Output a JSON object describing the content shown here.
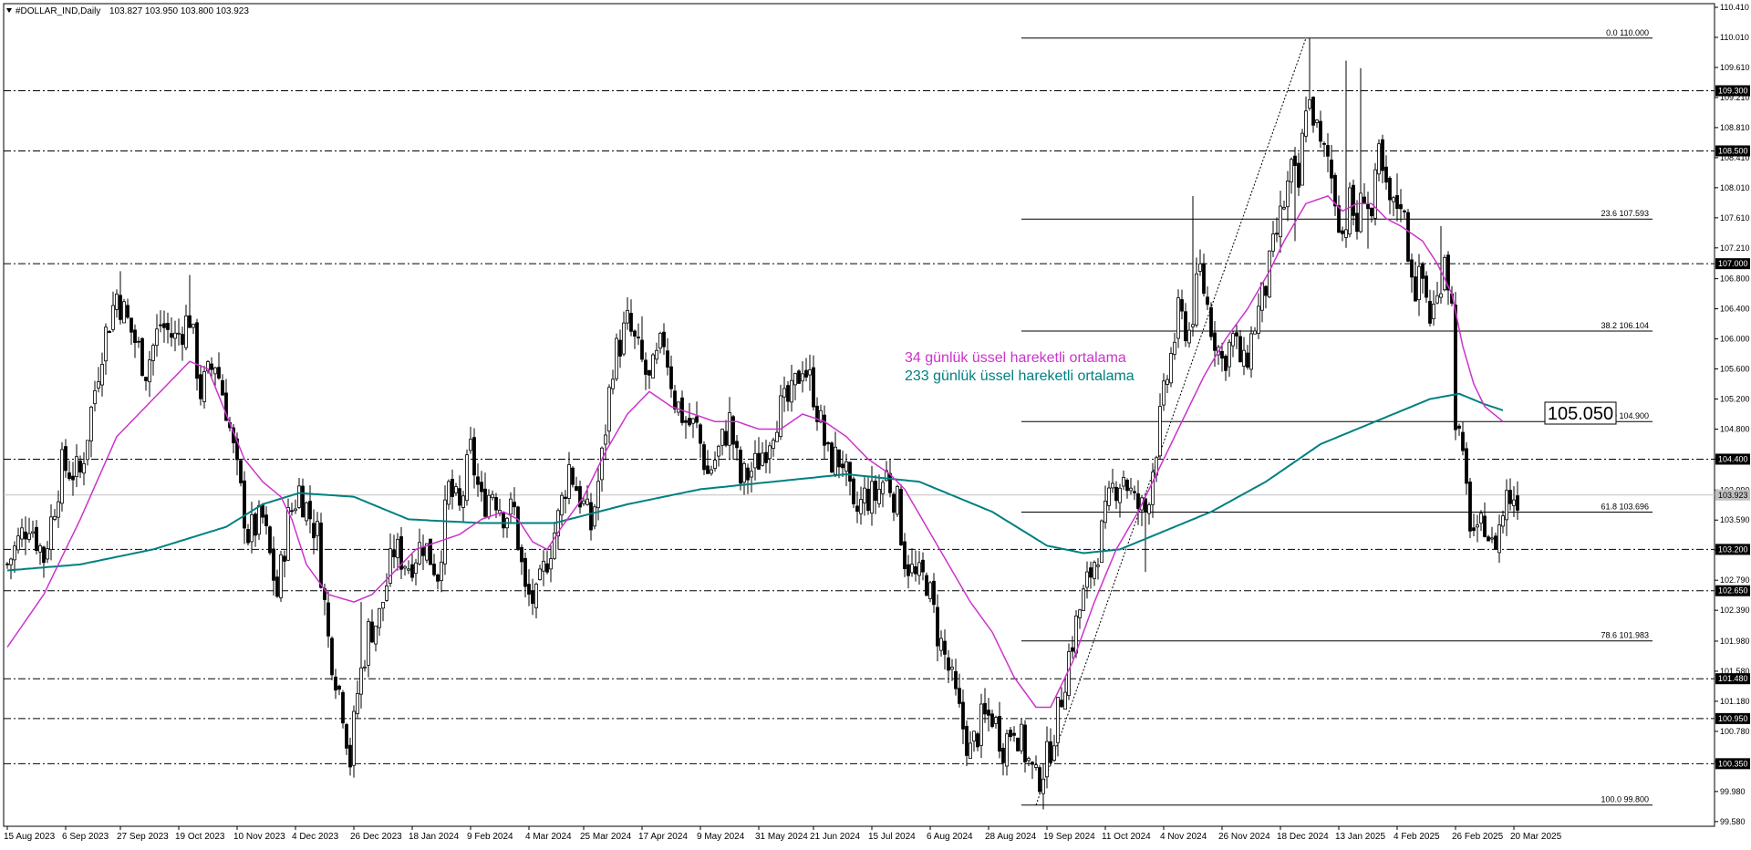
{
  "header": {
    "symbol_label": "#DOLLAR_IND,Daily",
    "ohlc_label": "103.827 103.950 103.800 103.923",
    "menu_icon": "triangle-down-icon"
  },
  "legend": {
    "ema34_label": "34 günlük üssel hareketli ortalama",
    "ema233_label": "233 günlük üssel hareketli ortalama"
  },
  "callout": {
    "value_label": "105.050"
  },
  "chart_data": {
    "type": "candlestick",
    "title": "",
    "xlabel": "",
    "ylabel": "",
    "ylim": [
      99.59,
      110.41
    ],
    "grid": false,
    "background": "#ffffff",
    "colors": {
      "candles": "#000000",
      "ema34": "#cc33cc",
      "ema233": "#008080",
      "levels": "#000000",
      "current_price_line": "#c0c0c0",
      "fibonacci": "#000000"
    },
    "y_ticks": [
      "110.410",
      "110.010",
      "109.610",
      "109.210",
      "108.810",
      "108.410",
      "108.010",
      "107.610",
      "107.210",
      "106.800",
      "106.400",
      "106.000",
      "105.600",
      "105.200",
      "104.800",
      "104.400",
      "103.990",
      "103.590",
      "103.190",
      "102.790",
      "102.390",
      "101.980",
      "101.580",
      "101.180",
      "100.780",
      "100.380",
      "99.980",
      "99.580"
    ],
    "x_ticks": [
      {
        "label": "15 Aug 2023",
        "i": 0
      },
      {
        "label": "6 Sep 2023",
        "i": 16
      },
      {
        "label": "27 Sep 2023",
        "i": 31
      },
      {
        "label": "19 Oct 2023",
        "i": 47
      },
      {
        "label": "10 Nov 2023",
        "i": 63
      },
      {
        "label": "4 Dec 2023",
        "i": 79
      },
      {
        "label": "26 Dec 2023",
        "i": 95
      },
      {
        "label": "18 Jan 2024",
        "i": 111
      },
      {
        "label": "9 Feb 2024",
        "i": 127
      },
      {
        "label": "4 Mar 2024",
        "i": 143
      },
      {
        "label": "25 Mar 2024",
        "i": 158
      },
      {
        "label": "17 Apr 2024",
        "i": 174
      },
      {
        "label": "9 May 2024",
        "i": 190
      },
      {
        "label": "31 May 2024",
        "i": 206
      },
      {
        "label": "21 Jun 2024",
        "i": 221
      },
      {
        "label": "15 Jul 2024",
        "i": 237
      },
      {
        "label": "6 Aug 2024",
        "i": 253
      },
      {
        "label": "28 Aug 2024",
        "i": 269
      },
      {
        "label": "19 Sep 2024",
        "i": 285
      },
      {
        "label": "11 Oct 2024",
        "i": 301
      },
      {
        "label": "4 Nov 2024",
        "i": 317
      },
      {
        "label": "26 Nov 2024",
        "i": 333
      },
      {
        "label": "18 Dec 2024",
        "i": 349
      },
      {
        "label": "13 Jan 2025",
        "i": 365
      },
      {
        "label": "4 Feb 2025",
        "i": 381
      },
      {
        "label": "26 Feb 2025",
        "i": 397
      },
      {
        "label": "20 Mar 2025",
        "i": 413
      }
    ],
    "total_bars": 418,
    "horizontal_levels": [
      {
        "value": 109.3,
        "label": "109.300"
      },
      {
        "value": 108.5,
        "label": "108.500"
      },
      {
        "value": 107.0,
        "label": "107.000"
      },
      {
        "value": 104.4,
        "label": "104.400"
      },
      {
        "value": 103.2,
        "label": "103.200"
      },
      {
        "value": 102.65,
        "label": "102.650"
      },
      {
        "value": 101.48,
        "label": "101.480"
      },
      {
        "value": 100.95,
        "label": "100.950"
      },
      {
        "value": 100.35,
        "label": "100.350"
      }
    ],
    "current_price": {
      "value": 103.923,
      "label": "103.923"
    },
    "fibonacci": {
      "start_i": 278,
      "end_i": 451,
      "swing_low": {
        "i": 282,
        "value": 99.8
      },
      "swing_high": {
        "i": 356,
        "value": 110.0
      },
      "levels": [
        {
          "value": 110.0,
          "label": "0.0 110.000"
        },
        {
          "value": 107.593,
          "label": "23.6 107.593"
        },
        {
          "value": 106.104,
          "label": "38.2 106.104"
        },
        {
          "value": 104.9,
          "label": "50.0 104.900"
        },
        {
          "value": 103.696,
          "label": "61.8 103.696"
        },
        {
          "value": 101.983,
          "label": "78.6 101.983"
        },
        {
          "value": 99.8,
          "label": "100.0 99.800"
        }
      ]
    },
    "close_path": [
      [
        0,
        103.0
      ],
      [
        6,
        103.6
      ],
      [
        10,
        103.1
      ],
      [
        15,
        104.3
      ],
      [
        20,
        104.2
      ],
      [
        26,
        105.9
      ],
      [
        30,
        106.6
      ],
      [
        34,
        106.1
      ],
      [
        38,
        105.6
      ],
      [
        42,
        106.2
      ],
      [
        46,
        106.0
      ],
      [
        50,
        106.3
      ],
      [
        53,
        105.3
      ],
      [
        57,
        105.7
      ],
      [
        60,
        105.1
      ],
      [
        63,
        104.2
      ],
      [
        66,
        103.4
      ],
      [
        70,
        103.6
      ],
      [
        74,
        102.6
      ],
      [
        77,
        103.6
      ],
      [
        80,
        104.0
      ],
      [
        85,
        103.4
      ],
      [
        88,
        102.0
      ],
      [
        92,
        101.1
      ],
      [
        94,
        100.4
      ],
      [
        96,
        101.3
      ],
      [
        99,
        102.1
      ],
      [
        102,
        102.3
      ],
      [
        106,
        103.2
      ],
      [
        110,
        103.0
      ],
      [
        114,
        103.3
      ],
      [
        118,
        102.9
      ],
      [
        121,
        104.0
      ],
      [
        124,
        103.7
      ],
      [
        127,
        104.5
      ],
      [
        130,
        103.8
      ],
      [
        133,
        104.0
      ],
      [
        136,
        103.7
      ],
      [
        139,
        103.7
      ],
      [
        142,
        102.6
      ],
      [
        145,
        102.5
      ],
      [
        148,
        103.1
      ],
      [
        151,
        103.6
      ],
      [
        154,
        104.3
      ],
      [
        157,
        103.9
      ],
      [
        160,
        103.5
      ],
      [
        163,
        104.4
      ],
      [
        166,
        105.7
      ],
      [
        170,
        106.2
      ],
      [
        173,
        105.8
      ],
      [
        176,
        105.4
      ],
      [
        180,
        106.0
      ],
      [
        183,
        105.2
      ],
      [
        186,
        104.9
      ],
      [
        189,
        104.8
      ],
      [
        192,
        104.2
      ],
      [
        195,
        104.5
      ],
      [
        198,
        104.9
      ],
      [
        201,
        104.1
      ],
      [
        205,
        104.3
      ],
      [
        208,
        104.6
      ],
      [
        211,
        105.0
      ],
      [
        215,
        105.2
      ],
      [
        218,
        105.7
      ],
      [
        221,
        105.3
      ],
      [
        225,
        104.4
      ],
      [
        229,
        104.4
      ],
      [
        232,
        103.6
      ],
      [
        235,
        103.9
      ],
      [
        238,
        103.9
      ],
      [
        241,
        104.2
      ],
      [
        244,
        103.8
      ],
      [
        246,
        103.1
      ],
      [
        249,
        102.8
      ],
      [
        252,
        102.8
      ],
      [
        255,
        102.1
      ],
      [
        258,
        101.6
      ],
      [
        261,
        101.0
      ],
      [
        264,
        100.5
      ],
      [
        267,
        100.9
      ],
      [
        270,
        101.0
      ],
      [
        273,
        100.6
      ],
      [
        276,
        100.9
      ],
      [
        279,
        100.5
      ],
      [
        282,
        100.1
      ],
      [
        285,
        100.4
      ],
      [
        288,
        101.0
      ],
      [
        291,
        101.8
      ],
      [
        294,
        102.4
      ],
      [
        297,
        102.9
      ],
      [
        300,
        103.4
      ],
      [
        303,
        104.0
      ],
      [
        306,
        104.2
      ],
      [
        309,
        103.8
      ],
      [
        312,
        103.7
      ],
      [
        315,
        104.6
      ],
      [
        318,
        105.5
      ],
      [
        321,
        106.3
      ],
      [
        324,
        106.1
      ],
      [
        327,
        106.9
      ],
      [
        330,
        106.2
      ],
      [
        333,
        105.7
      ],
      [
        336,
        106.0
      ],
      [
        339,
        105.6
      ],
      [
        342,
        106.2
      ],
      [
        345,
        106.7
      ],
      [
        348,
        107.4
      ],
      [
        350,
        107.8
      ],
      [
        352,
        108.2
      ],
      [
        354,
        108.0
      ],
      [
        356,
        109.2
      ],
      [
        358,
        109.0
      ],
      [
        360,
        108.5
      ],
      [
        362,
        108.4
      ],
      [
        364,
        107.9
      ],
      [
        366,
        107.4
      ],
      [
        368,
        107.8
      ],
      [
        370,
        107.5
      ],
      [
        372,
        108.0
      ],
      [
        374,
        107.6
      ],
      [
        376,
        108.4
      ],
      [
        378,
        107.9
      ],
      [
        380,
        107.7
      ],
      [
        382,
        107.9
      ],
      [
        384,
        107.2
      ],
      [
        386,
        106.7
      ],
      [
        388,
        106.8
      ],
      [
        390,
        106.3
      ],
      [
        392,
        106.5
      ],
      [
        394,
        107.2
      ],
      [
        396,
        106.4
      ],
      [
        397,
        105.0
      ],
      [
        399,
        104.3
      ],
      [
        401,
        103.6
      ],
      [
        403,
        103.3
      ],
      [
        405,
        103.6
      ],
      [
        407,
        103.2
      ],
      [
        409,
        103.5
      ],
      [
        411,
        103.9
      ],
      [
        414,
        103.923
      ]
    ],
    "spikes": [
      [
        31,
        106.9
      ],
      [
        50,
        106.85
      ],
      [
        97,
        102.5
      ],
      [
        174,
        106.3
      ],
      [
        325,
        107.9
      ],
      [
        357,
        110.0
      ],
      [
        367,
        109.7
      ],
      [
        371,
        109.6
      ],
      [
        373,
        107.2
      ],
      [
        381,
        108.2
      ],
      [
        393,
        107.5
      ],
      [
        312,
        102.9
      ],
      [
        353,
        107.3
      ]
    ],
    "ema34_path": [
      [
        0,
        101.9
      ],
      [
        10,
        102.6
      ],
      [
        20,
        103.6
      ],
      [
        30,
        104.7
      ],
      [
        40,
        105.2
      ],
      [
        50,
        105.7
      ],
      [
        55,
        105.6
      ],
      [
        60,
        105.0
      ],
      [
        65,
        104.4
      ],
      [
        70,
        104.1
      ],
      [
        75,
        103.9
      ],
      [
        78,
        103.6
      ],
      [
        82,
        103.0
      ],
      [
        88,
        102.6
      ],
      [
        95,
        102.5
      ],
      [
        100,
        102.6
      ],
      [
        106,
        102.9
      ],
      [
        112,
        103.2
      ],
      [
        118,
        103.3
      ],
      [
        124,
        103.4
      ],
      [
        130,
        103.6
      ],
      [
        136,
        103.7
      ],
      [
        140,
        103.6
      ],
      [
        144,
        103.3
      ],
      [
        148,
        103.2
      ],
      [
        152,
        103.5
      ],
      [
        158,
        103.9
      ],
      [
        164,
        104.5
      ],
      [
        170,
        105.0
      ],
      [
        176,
        105.3
      ],
      [
        182,
        105.1
      ],
      [
        188,
        105.0
      ],
      [
        194,
        104.9
      ],
      [
        200,
        104.9
      ],
      [
        206,
        104.8
      ],
      [
        212,
        104.8
      ],
      [
        218,
        105.0
      ],
      [
        224,
        104.9
      ],
      [
        230,
        104.7
      ],
      [
        236,
        104.4
      ],
      [
        242,
        104.2
      ],
      [
        246,
        104.0
      ],
      [
        252,
        103.5
      ],
      [
        258,
        103.0
      ],
      [
        264,
        102.5
      ],
      [
        270,
        102.1
      ],
      [
        276,
        101.5
      ],
      [
        282,
        101.1
      ],
      [
        286,
        101.1
      ],
      [
        292,
        101.7
      ],
      [
        298,
        102.5
      ],
      [
        304,
        103.2
      ],
      [
        310,
        103.7
      ],
      [
        316,
        104.3
      ],
      [
        322,
        104.9
      ],
      [
        328,
        105.5
      ],
      [
        334,
        106.0
      ],
      [
        340,
        106.4
      ],
      [
        346,
        106.9
      ],
      [
        350,
        107.3
      ],
      [
        356,
        107.8
      ],
      [
        362,
        107.9
      ],
      [
        366,
        107.7
      ],
      [
        370,
        107.8
      ],
      [
        374,
        107.8
      ],
      [
        378,
        107.6
      ],
      [
        382,
        107.5
      ],
      [
        388,
        107.3
      ],
      [
        392,
        107.0
      ],
      [
        396,
        106.6
      ],
      [
        399,
        105.9
      ],
      [
        402,
        105.4
      ],
      [
        405,
        105.1
      ],
      [
        410,
        104.9
      ]
    ],
    "ema233_path": [
      [
        0,
        102.92
      ],
      [
        20,
        103.0
      ],
      [
        40,
        103.2
      ],
      [
        60,
        103.5
      ],
      [
        70,
        103.8
      ],
      [
        80,
        103.95
      ],
      [
        95,
        103.9
      ],
      [
        110,
        103.6
      ],
      [
        130,
        103.55
      ],
      [
        150,
        103.55
      ],
      [
        170,
        103.8
      ],
      [
        190,
        104.0
      ],
      [
        210,
        104.1
      ],
      [
        230,
        104.2
      ],
      [
        250,
        104.1
      ],
      [
        270,
        103.7
      ],
      [
        285,
        103.25
      ],
      [
        295,
        103.15
      ],
      [
        305,
        103.2
      ],
      [
        315,
        103.4
      ],
      [
        330,
        103.7
      ],
      [
        345,
        104.1
      ],
      [
        360,
        104.6
      ],
      [
        375,
        104.9
      ],
      [
        390,
        105.2
      ],
      [
        398,
        105.27
      ],
      [
        405,
        105.13
      ],
      [
        410,
        105.05
      ]
    ]
  }
}
